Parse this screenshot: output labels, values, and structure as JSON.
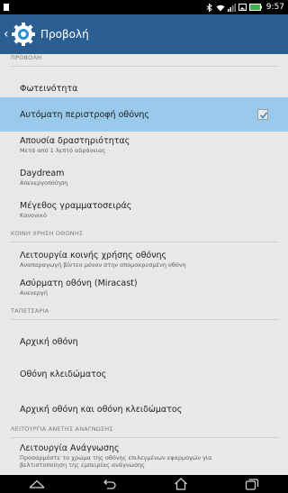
{
  "status_bar": {
    "time": "9:57"
  },
  "header": {
    "title": "Προβολή"
  },
  "sections": {
    "display_header": "ΠΡΟΒΟΛΗ",
    "screen_share_header": "ΚΟΙΝΗ ΧΡΗΣΗ ΟΘΟΝΗΣ",
    "wallpaper_header": "ΤΑΠΕΤΣΑΡΙΑ",
    "reading_header": "ΛΕΙΤΟΥΡΓΙΑ ΑΝΕΤΗΣ ΑΝΑΓΝΩΣΗΣ"
  },
  "items": {
    "brightness": {
      "title": "Φωτεινότητα"
    },
    "auto_rotate": {
      "title": "Αυτόματη περιστροφή οθόνης",
      "checked": true
    },
    "sleep": {
      "title": "Απουσία δραστηριότητας",
      "subtitle": "Μετά από 1 λεπτό αδράνειας"
    },
    "daydream": {
      "title": "Daydream",
      "subtitle": "Απενεργοποίηση"
    },
    "font_size": {
      "title": "Μέγεθος γραμματοσειράς",
      "subtitle": "Κανονικό"
    },
    "screen_share": {
      "title": "Λειτουργία κοινής χρήσης οθόνης",
      "subtitle": "Αναπαραγωγή βίντεο μόνον στην απομακρυσμένη οθόνη"
    },
    "wireless_display": {
      "title": "Ασύρματη οθόνη (Miracast)",
      "subtitle": "Ανενεργή"
    },
    "home_screen": {
      "title": "Αρχική οθόνη"
    },
    "lock_screen": {
      "title": "Οθόνη κλειδώματος"
    },
    "home_and_lock": {
      "title": "Αρχική οθόνη και οθόνη κλειδώματος"
    },
    "reading_mode": {
      "title": "Λειτουργία Ανάγνωσης",
      "subtitle": "Προσαρμόστε το χρώμα της οθόνης επιλεγμένων εφαρμογών για βελτιστοποίηση της εμπειρίας ανάγνωσης"
    }
  },
  "colors": {
    "action_bar": "#2b5f92",
    "highlight": "#99c9eb",
    "background": "#e8e8e8",
    "checkmark": "#4a90c8"
  },
  "icons": {
    "header": "gear-icon",
    "nav": [
      "collapse-icon",
      "back-icon",
      "home-icon",
      "recent-apps-icon"
    ]
  }
}
